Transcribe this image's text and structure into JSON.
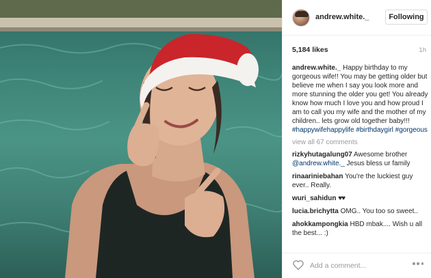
{
  "post": {
    "username": "andrew.white._",
    "follow_label": "Following",
    "likes": "5,184 likes",
    "time": "1h",
    "caption": {
      "username": "andrew.white._",
      "text": "Happy birthday to my gorgeous wife!! You may be getting older but believe me when I say you look more and more stunning the older you get! You already know how much I love you and how proud I am to call you my wife and the mother of my children.. lets grow old together baby!!!",
      "hashtags": [
        "#happywifehappylife",
        "#birthdaygirl",
        "#gorgeous"
      ]
    },
    "view_all": "view all 67 comments",
    "comments": [
      {
        "username": "rizkyhutagalung07",
        "text": "Awesome brother",
        "mention": "@andrew.white._",
        "text_after": "Jesus bless ur family"
      },
      {
        "username": "rinaariniebahan",
        "text": "You're the luckiest guy ever.. Really."
      },
      {
        "username": "wuri_sahidun",
        "text": "♥♥"
      },
      {
        "username": "lucia.brichytta",
        "text": "OMG.. You too so sweet.."
      },
      {
        "username": "ahokkampongkia",
        "text": "HBD mbak.... Wish u all the best... :)"
      }
    ],
    "add_comment_placeholder": "Add a comment...",
    "icons": {
      "like": "heart-outline-icon",
      "more": "more-options-icon"
    }
  }
}
